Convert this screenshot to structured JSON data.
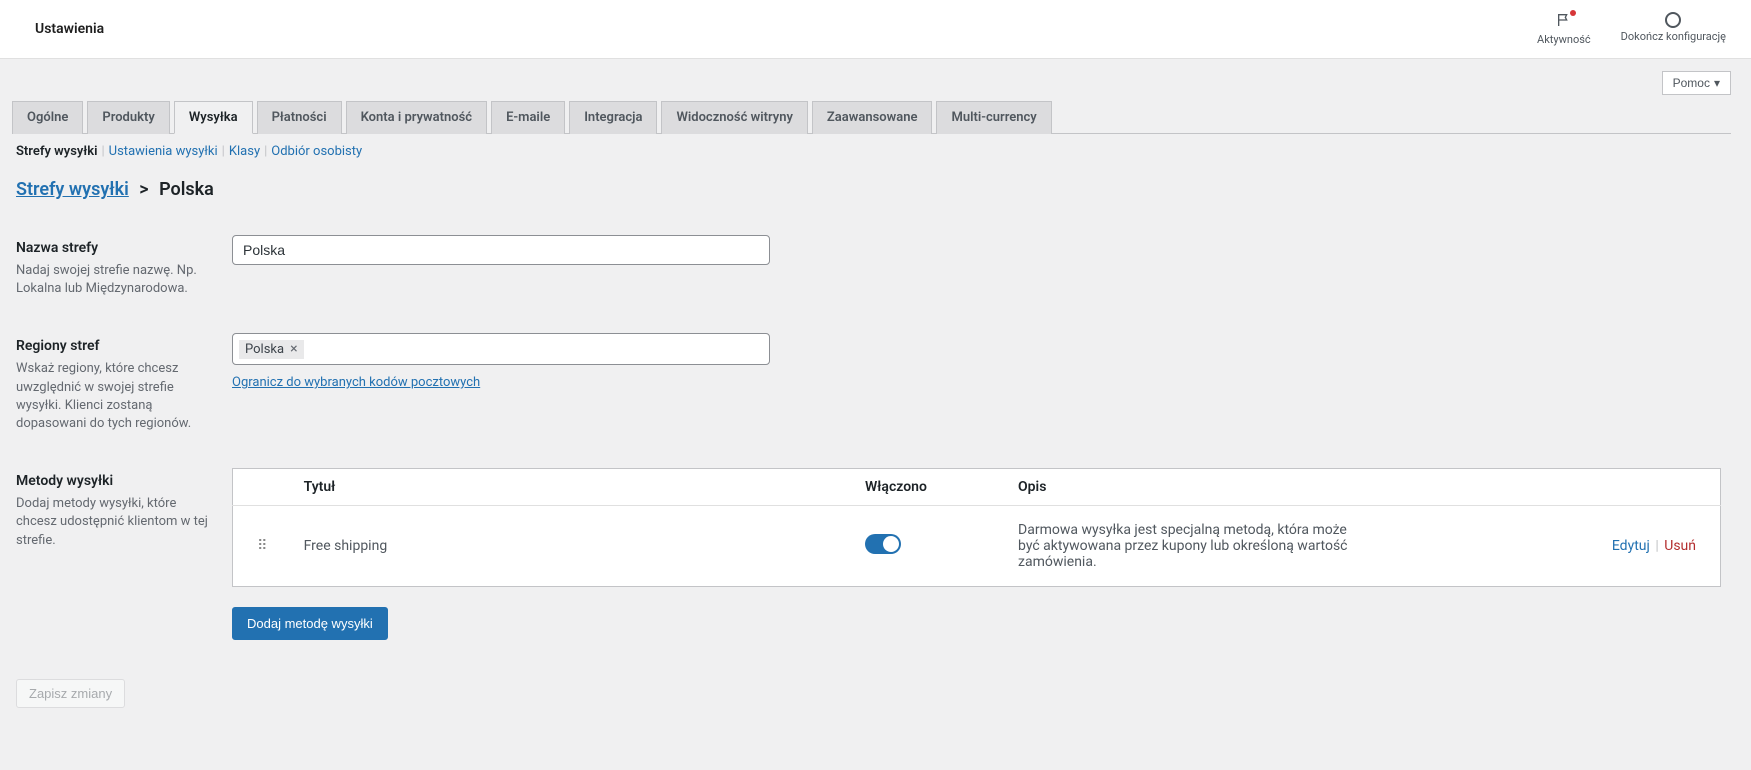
{
  "top_bar": {
    "title": "Ustawienia",
    "activity": "Aktywność",
    "finish": "Dokończ konfigurację"
  },
  "help_button": "Pomoc",
  "tabs": [
    "Ogólne",
    "Produkty",
    "Wysyłka",
    "Płatności",
    "Konta i prywatność",
    "E-maile",
    "Integracja",
    "Widoczność witryny",
    "Zaawansowane",
    "Multi-currency"
  ],
  "active_tab_index": 2,
  "subnav": {
    "items": [
      "Strefy wysyłki",
      "Ustawienia wysyłki",
      "Klasy",
      "Odbiór osobisty"
    ],
    "current_index": 0
  },
  "breadcrumb": {
    "root": "Strefy wysyłki",
    "current": "Polska"
  },
  "zone_name": {
    "label": "Nazwa strefy",
    "desc": "Nadaj swojej strefie nazwę. Np. Lokalna lub Międzynarodowa.",
    "value": "Polska"
  },
  "zone_regions": {
    "label": "Regiony stref",
    "desc": "Wskaż regiony, które chcesz uwzględnić w swojej strefie wysyłki. Klienci zostaną dopasowani do tych regionów.",
    "tags": [
      "Polska"
    ],
    "limit_link": "Ogranicz do wybranych kodów pocztowych"
  },
  "methods": {
    "label": "Metody wysyłki",
    "desc": "Dodaj metody wysyłki, które chcesz udostępnić klientom w tej strefie.",
    "columns": {
      "title": "Tytuł",
      "enabled": "Włączono",
      "desc": "Opis"
    },
    "rows": [
      {
        "title": "Free shipping",
        "enabled": true,
        "desc": "Darmowa wysyłka jest specjalną metodą, która może być aktywowana przez kupony lub określoną wartość zamówienia."
      }
    ],
    "actions": {
      "edit": "Edytuj",
      "delete": "Usuń"
    },
    "add_button": "Dodaj metodę wysyłki"
  },
  "save_button": "Zapisz zmiany"
}
